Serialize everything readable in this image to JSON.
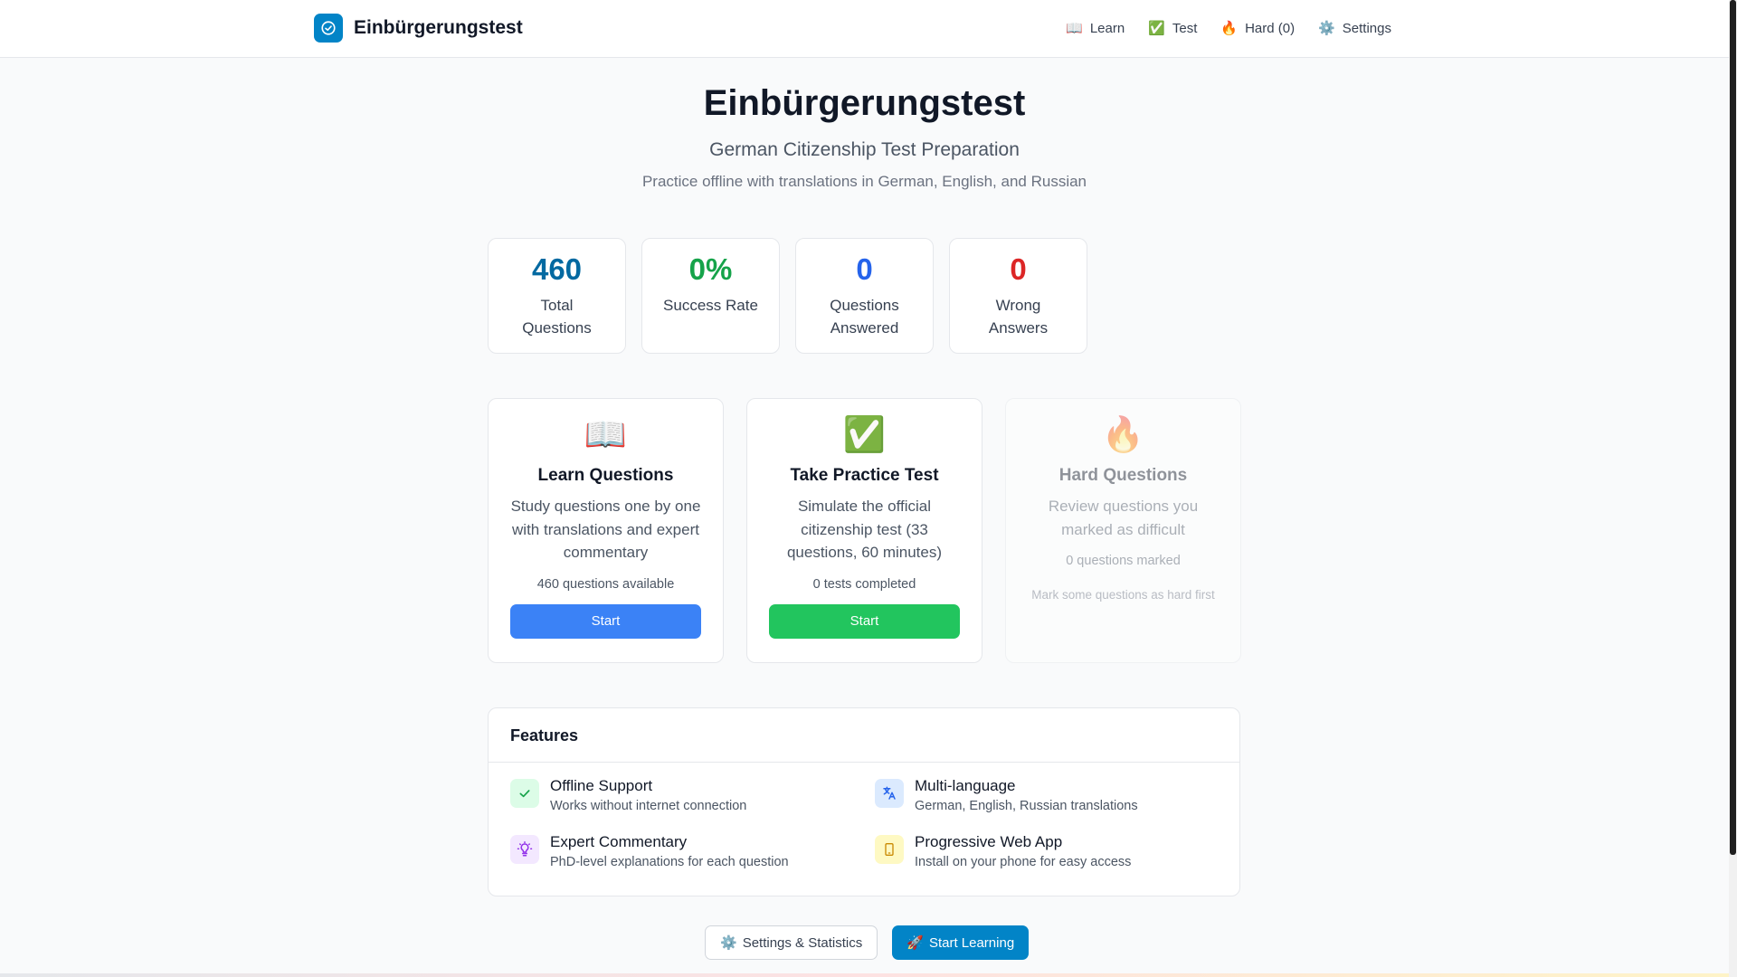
{
  "header": {
    "brand": "Einbürgerungstest",
    "nav": [
      {
        "icon": "📖",
        "label": "Learn"
      },
      {
        "icon": "✅",
        "label": "Test"
      },
      {
        "icon": "🔥",
        "label": "Hard (0)"
      },
      {
        "icon": "⚙️",
        "label": "Settings"
      }
    ]
  },
  "hero": {
    "title": "Einbürgerungstest",
    "subtitle": "German Citizenship Test Preparation",
    "tagline": "Practice offline with translations in German, English, and Russian"
  },
  "stats": [
    {
      "value": "460",
      "label": "Total Questions",
      "color": "#0369a1"
    },
    {
      "value": "0%",
      "label": "Success Rate",
      "color": "#16a34a"
    },
    {
      "value": "0",
      "label": "Questions Answered",
      "color": "#2563eb"
    },
    {
      "value": "0",
      "label": "Wrong Answers",
      "color": "#dc2626"
    }
  ],
  "actions": {
    "learn": {
      "icon": "📖",
      "title": "Learn Questions",
      "desc": "Study questions one by one with translations and expert commentary",
      "meta": "460 questions available",
      "button": "Start",
      "color": "#3b82f6"
    },
    "test": {
      "icon": "✅",
      "title": "Take Practice Test",
      "desc": "Simulate the official citizenship test (33 questions, 60 minutes)",
      "meta": "0 tests completed",
      "button": "Start",
      "color": "#22c55e"
    },
    "hard": {
      "icon": "🔥",
      "title": "Hard Questions",
      "desc": "Review questions you marked as difficult",
      "meta": "0 questions marked",
      "hint": "Mark some questions as hard first"
    }
  },
  "features": {
    "heading": "Features",
    "items": [
      {
        "title": "Offline Support",
        "desc": "Works without internet connection",
        "icon": "check-icon",
        "bg": "#dcfce7",
        "fg": "#16a34a"
      },
      {
        "title": "Multi-language",
        "desc": "German, English, Russian translations",
        "icon": "translate-icon",
        "bg": "#dbeafe",
        "fg": "#2563eb"
      },
      {
        "title": "Expert Commentary",
        "desc": "PhD-level explanations for each question",
        "icon": "lightbulb-icon",
        "bg": "#f3e8ff",
        "fg": "#9333ea"
      },
      {
        "title": "Progressive Web App",
        "desc": "Install on your phone for easy access",
        "icon": "phone-icon",
        "bg": "#fef9c3",
        "fg": "#ca8a04"
      }
    ]
  },
  "bottom": {
    "settings_icon": "⚙️",
    "settings_label": "Settings & Statistics",
    "start_icon": "🚀",
    "start_label": "Start Learning"
  }
}
